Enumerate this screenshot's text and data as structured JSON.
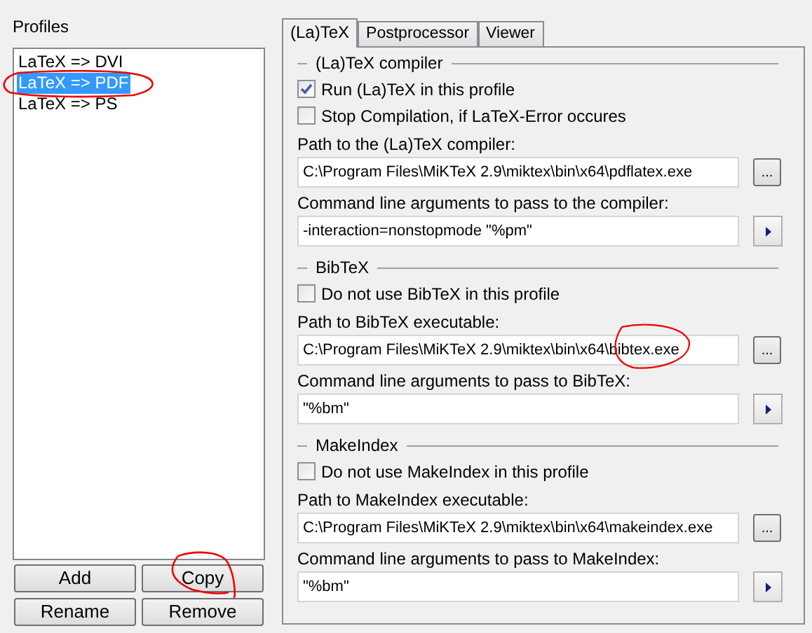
{
  "profiles": {
    "label": "Profiles",
    "items": [
      {
        "label": "LaTeX => DVI",
        "selected": false
      },
      {
        "label": "LaTeX => PDF",
        "selected": true
      },
      {
        "label": "LaTeX => PS",
        "selected": false
      }
    ],
    "buttons": [
      "Add",
      "Copy",
      "Rename",
      "Remove"
    ]
  },
  "tabs": [
    {
      "label": "(La)TeX",
      "selected": true
    },
    {
      "label": "Postprocessor",
      "selected": false
    },
    {
      "label": "Viewer",
      "selected": false
    }
  ],
  "groups": [
    {
      "title": "(La)TeX compiler",
      "checkboxes": [
        {
          "label": "Run (La)TeX in this profile",
          "checked": true
        },
        {
          "label": "Stop Compilation, if LaTeX-Error occures",
          "checked": false
        }
      ],
      "fields": [
        {
          "label": "Path to the (La)TeX compiler:",
          "value": "C:\\Program Files\\MiKTeX 2.9\\miktex\\bin\\x64\\pdflatex.exe",
          "kind": "browse",
          "button": "..."
        },
        {
          "label": "Command line arguments to pass to the compiler:",
          "value": "-interaction=nonstopmode \"%pm\"",
          "kind": "run"
        }
      ]
    },
    {
      "title": "BibTeX",
      "checkboxes": [
        {
          "label": "Do not use BibTeX in this profile",
          "checked": false
        }
      ],
      "fields": [
        {
          "label": "Path to BibTeX executable:",
          "value": "C:\\Program Files\\MiKTeX 2.9\\miktex\\bin\\x64\\bibtex.exe",
          "kind": "browse",
          "button": "..."
        },
        {
          "label": "Command line arguments to pass to BibTeX:",
          "value": "\"%bm\"",
          "kind": "run"
        }
      ]
    },
    {
      "title": "MakeIndex",
      "checkboxes": [
        {
          "label": "Do not use MakeIndex in this profile",
          "checked": false
        }
      ],
      "fields": [
        {
          "label": "Path to MakeIndex executable:",
          "value": "C:\\Program Files\\MiKTeX 2.9\\miktex\\bin\\x64\\makeindex.exe",
          "kind": "browse",
          "button": "..."
        },
        {
          "label": "Command line arguments to pass to MakeIndex:",
          "value": "\"%bm\"",
          "kind": "run"
        }
      ]
    }
  ]
}
